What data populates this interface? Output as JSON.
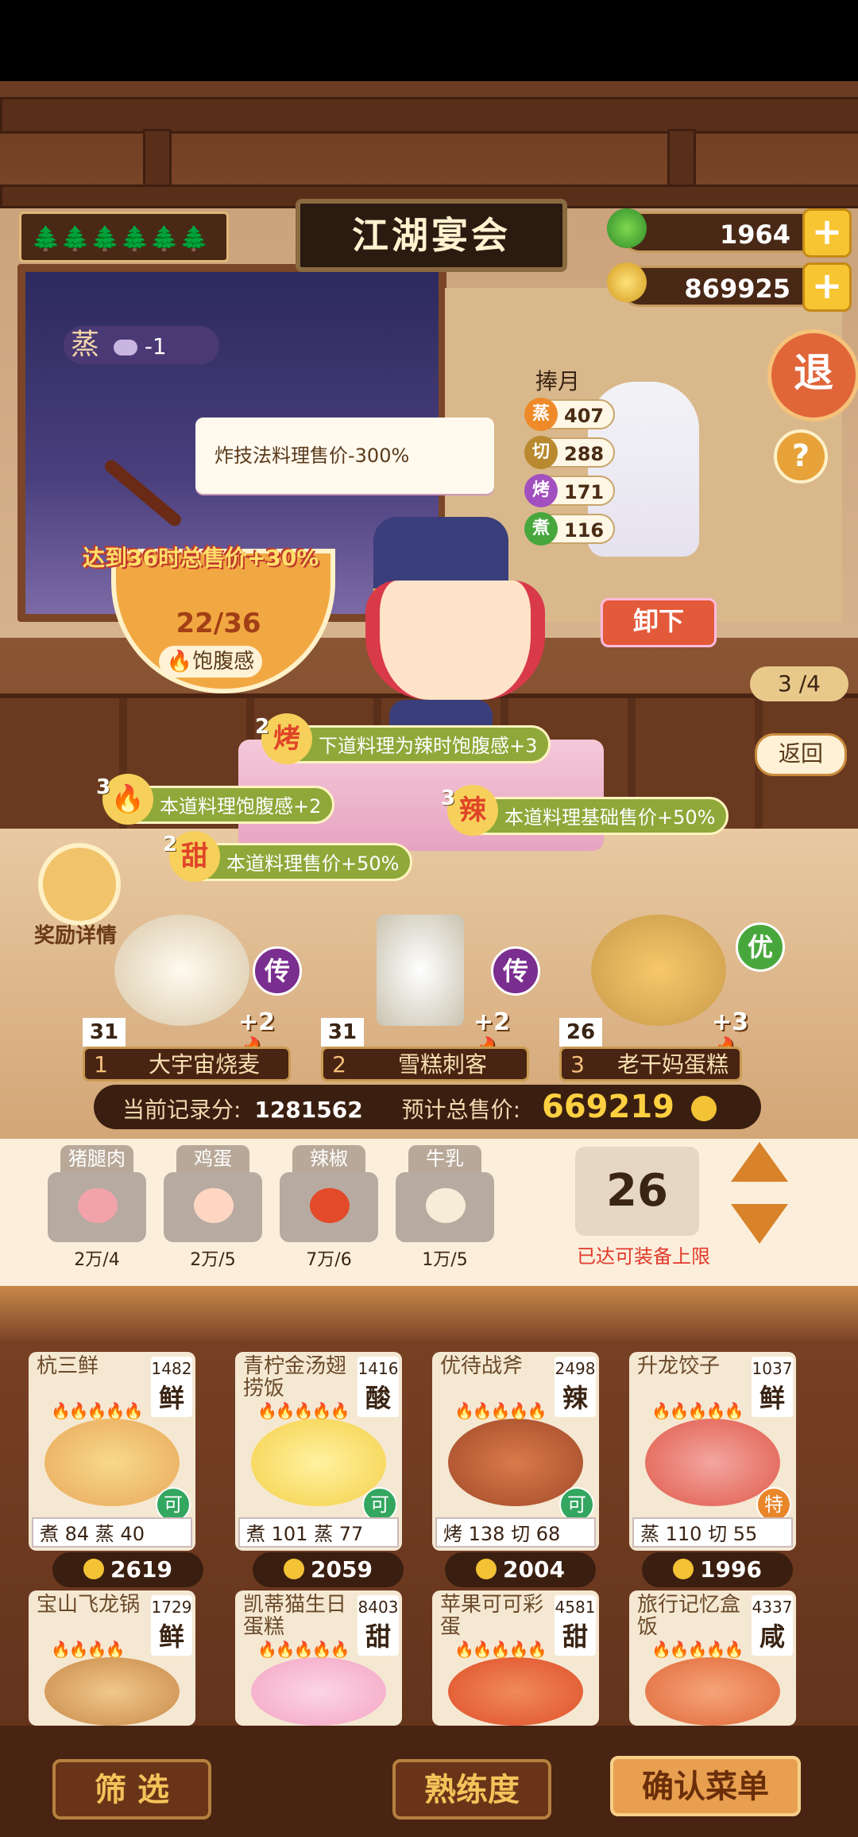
{
  "header": {
    "name_plate": "🌲🌲🌲🌲🌲🌲",
    "title": "江湖宴会",
    "jade": "1964",
    "coins": "869925",
    "exit_label": "退",
    "help_label": "?"
  },
  "scene": {
    "steam_tag": {
      "key": "蒸",
      "value": "-1"
    },
    "tooltip": "炸技法料理售价-300%",
    "bowl": {
      "goal": "达到36时总售价+30%",
      "count": "22/36",
      "label": "饱腹感"
    },
    "chef": {
      "name": "捧月",
      "stats": [
        {
          "key": "蒸",
          "value": "407",
          "color": "#ef8a2a"
        },
        {
          "key": "切",
          "value": "288",
          "color": "#b8892e"
        },
        {
          "key": "烤",
          "value": "171",
          "color": "#a24fc0"
        },
        {
          "key": "煮",
          "value": "116",
          "color": "#48a73c"
        }
      ],
      "unload_label": "卸下"
    },
    "page_indicator": "3 /4",
    "back_label": "返回",
    "buffs": [
      {
        "level": "2",
        "icon": "烤",
        "text": "下道料理为辣时饱腹感+3"
      },
      {
        "level": "3",
        "icon": "🔥",
        "text": "本道料理饱腹感+2"
      },
      {
        "level": "3",
        "icon": "辣",
        "text": "本道料理基础售价+50%"
      },
      {
        "level": "2",
        "icon": "甜",
        "text": "本道料理售价+50%"
      }
    ],
    "reward_label": "奖励详情",
    "served": [
      {
        "slot": "1",
        "name": "大宇宙烧麦",
        "level": "31",
        "bonus": "+2",
        "grade": "传"
      },
      {
        "slot": "2",
        "name": "雪糕刺客",
        "level": "31",
        "bonus": "+2",
        "grade": "传"
      },
      {
        "slot": "3",
        "name": "老干妈蛋糕",
        "level": "26",
        "bonus": "+3",
        "grade": "优"
      }
    ]
  },
  "score": {
    "record_label": "当前记录分:",
    "record_value": "1281562",
    "total_label": "预计总售价:",
    "total_value": "669219"
  },
  "ingredients": {
    "items": [
      {
        "name": "猪腿肉",
        "count": "2万/4",
        "color": "#f2a3a9"
      },
      {
        "name": "鸡蛋",
        "count": "2万/5",
        "color": "#ffd6c2"
      },
      {
        "name": "辣椒",
        "count": "7万/6",
        "color": "#e34a2a"
      },
      {
        "name": "牛乳",
        "count": "1万/5",
        "color": "#f7ecd7"
      }
    ],
    "equip_count": "26",
    "equip_limit": "已达可装备上限"
  },
  "dishes": {
    "row1": [
      {
        "name": "杭三鲜",
        "price": "1482",
        "flavor": "鲜",
        "flames": "🔥🔥🔥🔥🔥",
        "badge": "可",
        "skills": "煮  84   蒸  40",
        "gold": "2619",
        "color": "#e9a85a"
      },
      {
        "name": "青柠金汤翅捞饭",
        "price": "1416",
        "flavor": "酸",
        "flames": "🔥🔥🔥🔥🔥",
        "badge": "可",
        "skills": "煮  101  蒸  77",
        "gold": "2059",
        "color": "#f5d04a"
      },
      {
        "name": "优待战斧",
        "price": "2498",
        "flavor": "辣",
        "flames": "🔥🔥🔥🔥🔥",
        "badge": "可",
        "skills": "烤  138  切  68",
        "gold": "2004",
        "color": "#a24a2a"
      },
      {
        "name": "升龙饺子",
        "price": "1037",
        "flavor": "鲜",
        "flames": "🔥🔥🔥🔥🔥",
        "badge": "特",
        "skills": "蒸  110  切  55",
        "gold": "1996",
        "color": "#e05a4a"
      }
    ],
    "row2": [
      {
        "name": "宝山飞龙锅",
        "price": "1729",
        "flavor": "鲜",
        "flames": "🔥🔥🔥🔥",
        "color": "#c98a4a"
      },
      {
        "name": "凯蒂猫生日蛋糕",
        "price": "8403",
        "flavor": "甜",
        "flames": "🔥🔥🔥🔥🔥",
        "color": "#f4a4c4"
      },
      {
        "name": "苹果可可彩蛋",
        "price": "4581",
        "flavor": "甜",
        "flames": "🔥🔥🔥🔥🔥",
        "color": "#e0502a"
      },
      {
        "name": "旅行记忆盒饭",
        "price": "4337",
        "flavor": "咸",
        "flames": "🔥🔥🔥🔥🔥",
        "color": "#e06a3a"
      }
    ]
  },
  "footer": {
    "filter_label": "筛 选",
    "mastery_label": "熟练度",
    "confirm_label": "确认菜单"
  }
}
